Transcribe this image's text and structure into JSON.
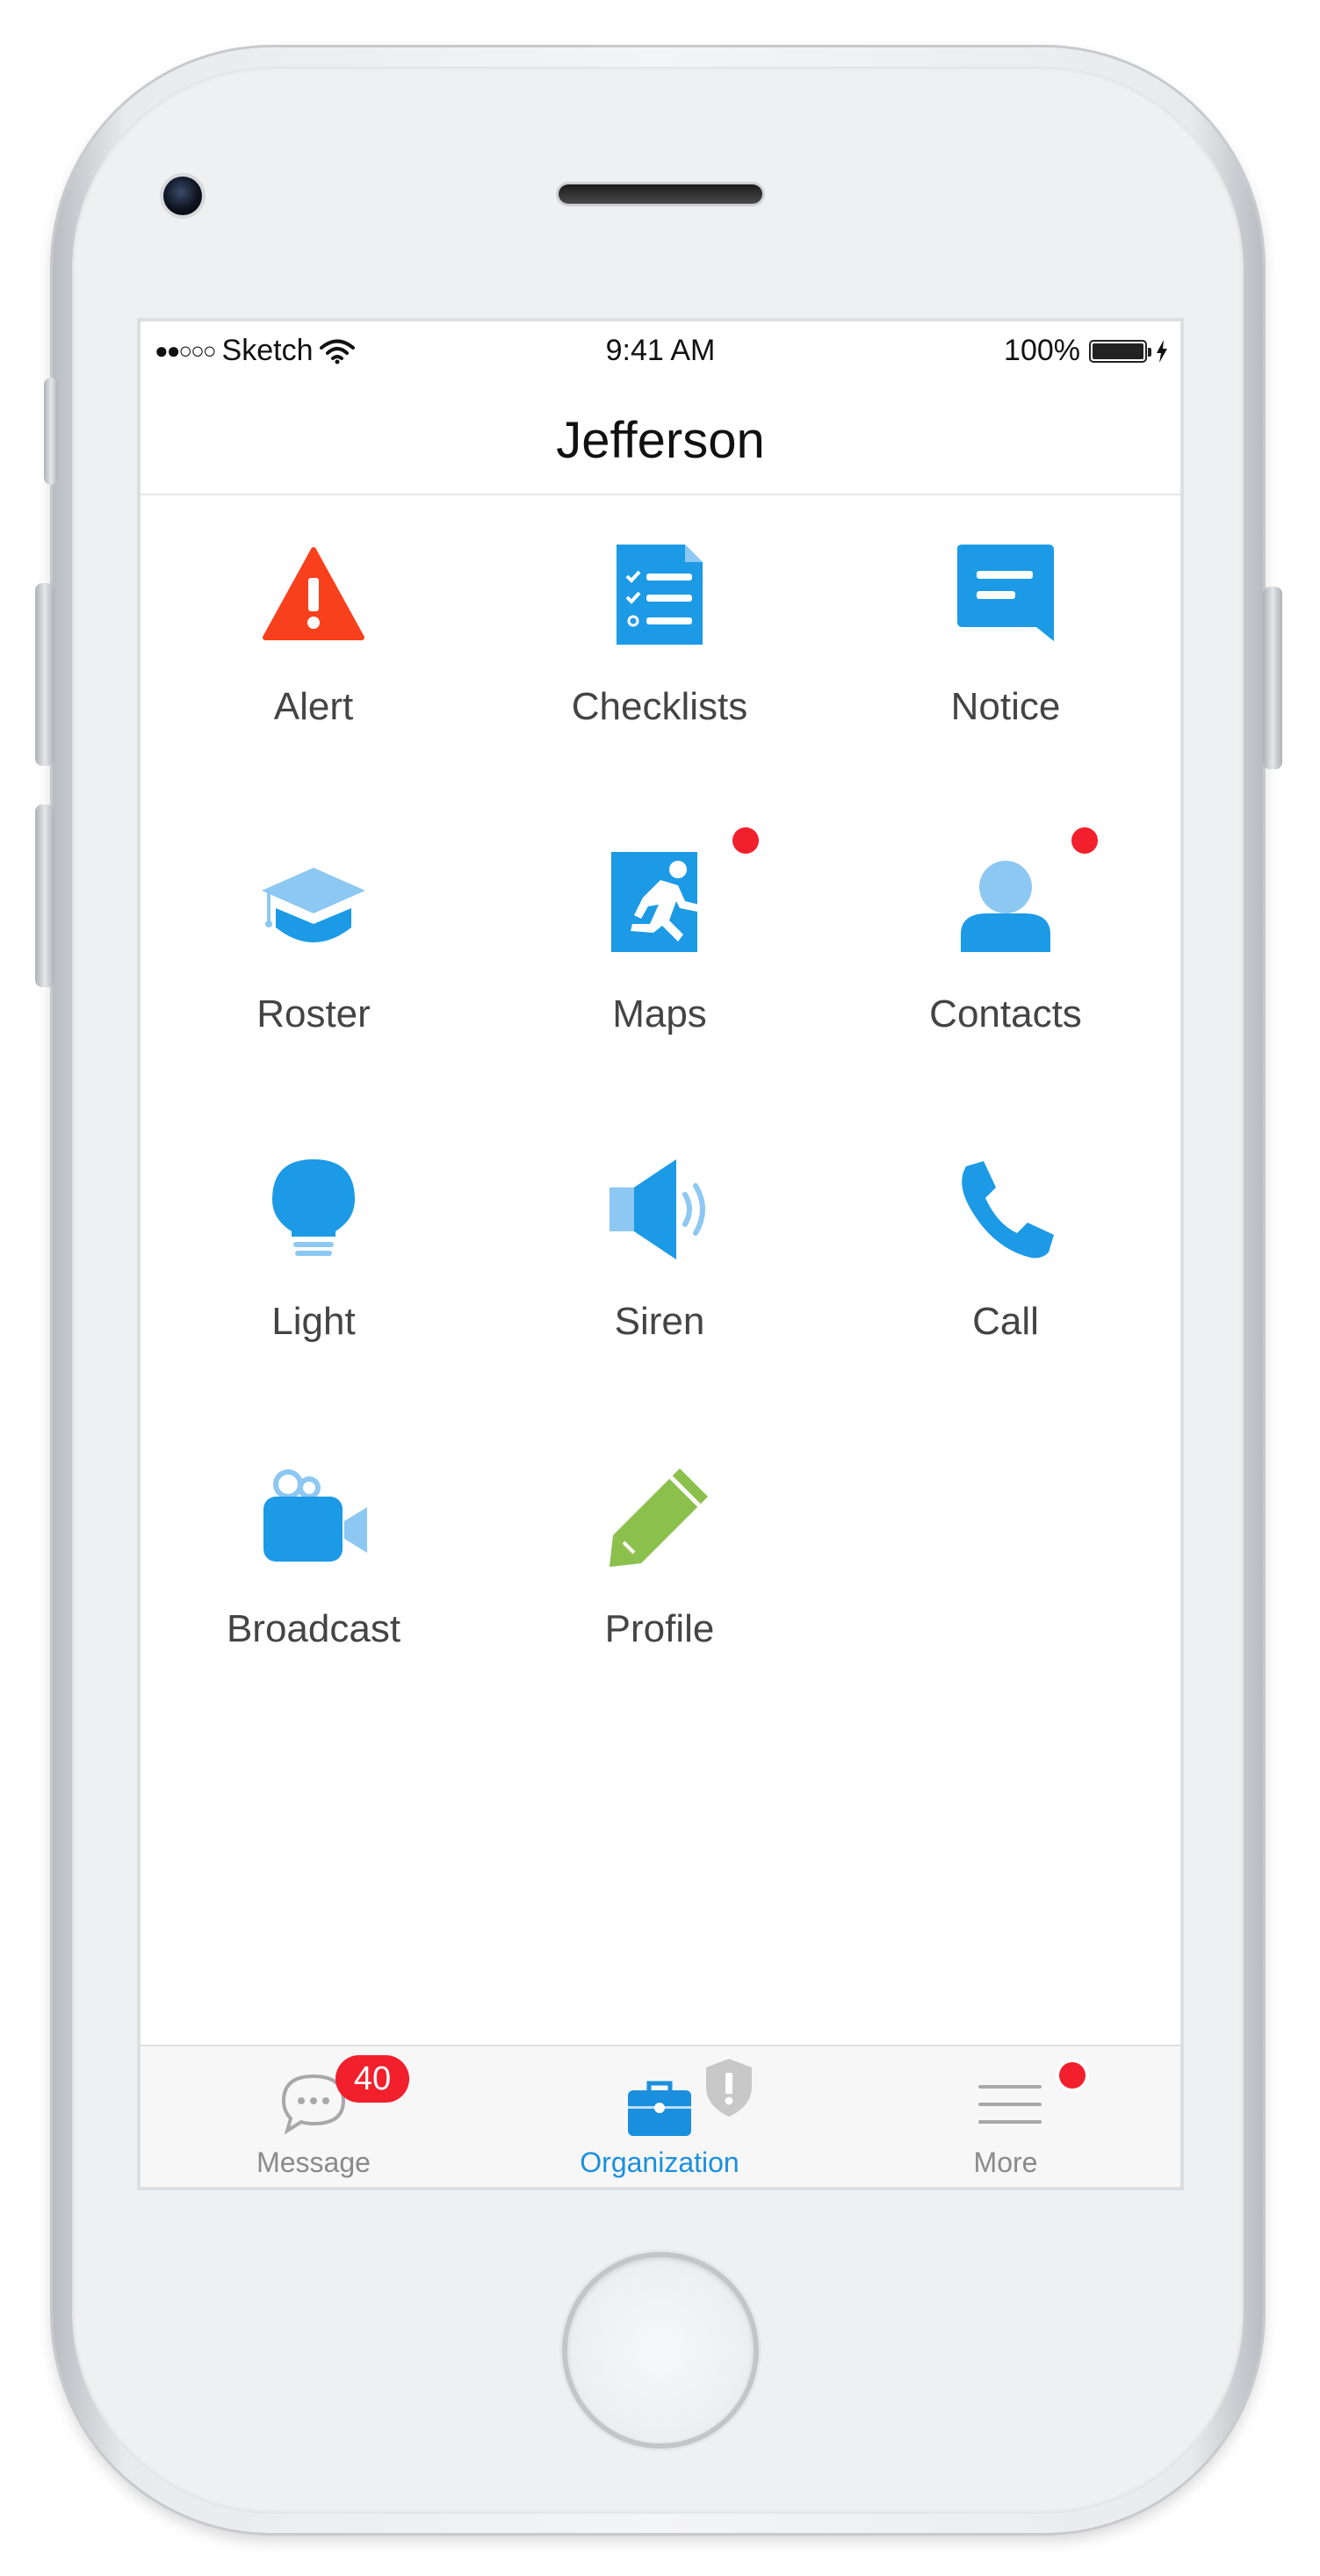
{
  "status_bar": {
    "carrier_signal": "●●○○○",
    "carrier": "Sketch",
    "time": "9:41 AM",
    "battery_percent": "100%",
    "battery_level": 1.0,
    "icons": [
      "wifi-icon",
      "battery-icon",
      "charging-bolt-icon"
    ]
  },
  "nav": {
    "title": "Jefferson"
  },
  "colors": {
    "alert": "#f8401c",
    "primary_blue": "#1c9ae6",
    "light_blue": "#8cc8f2",
    "profile_green": "#8cc04d",
    "badge_red": "#f21f2c",
    "tab_active": "#1a8fdd",
    "tab_inactive": "#8a8a8a"
  },
  "grid": {
    "items": [
      {
        "label": "Alert",
        "icon": "alert-triangle-icon",
        "notification_dot": false
      },
      {
        "label": "Checklists",
        "icon": "checklist-icon",
        "notification_dot": false
      },
      {
        "label": "Notice",
        "icon": "notice-message-icon",
        "notification_dot": false
      },
      {
        "label": "Roster",
        "icon": "graduation-cap-icon",
        "notification_dot": false
      },
      {
        "label": "Maps",
        "icon": "emergency-exit-icon",
        "notification_dot": true
      },
      {
        "label": "Contacts",
        "icon": "contact-person-icon",
        "notification_dot": true
      },
      {
        "label": "Light",
        "icon": "light-bulb-icon",
        "notification_dot": false
      },
      {
        "label": "Siren",
        "icon": "speaker-icon",
        "notification_dot": false
      },
      {
        "label": "Call",
        "icon": "phone-icon",
        "notification_dot": false
      },
      {
        "label": "Broadcast",
        "icon": "video-camera-icon",
        "notification_dot": false
      },
      {
        "label": "Profile",
        "icon": "pencil-icon",
        "notification_dot": false
      }
    ]
  },
  "tab_bar": {
    "tabs": [
      {
        "label": "Message",
        "icon": "chat-bubble-icon",
        "badge": "40",
        "active": false
      },
      {
        "label": "Organization",
        "icon": "briefcase-icon",
        "secondary_icon": "shield-alert-icon",
        "active": true
      },
      {
        "label": "More",
        "icon": "menu-lines-icon",
        "notification_dot": true,
        "active": false
      }
    ]
  }
}
